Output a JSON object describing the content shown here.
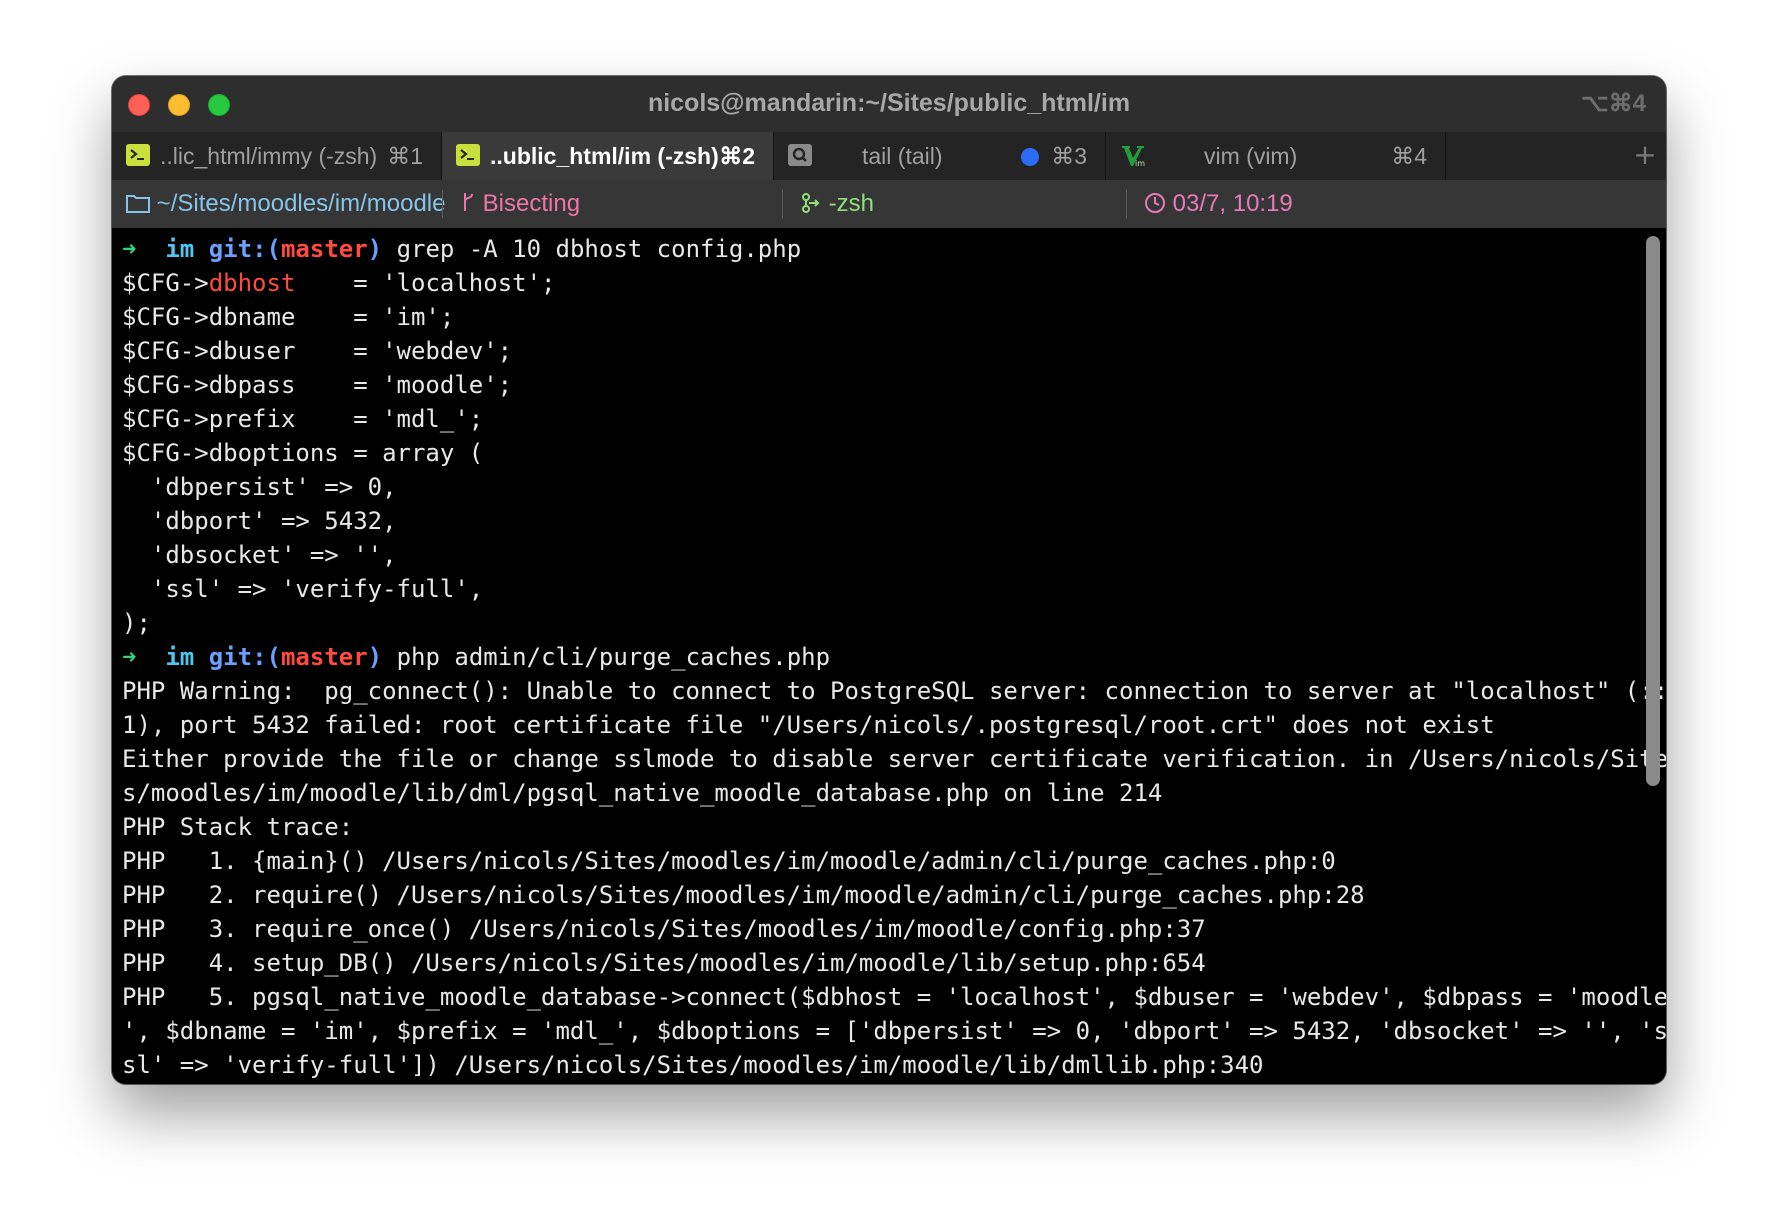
{
  "window": {
    "title": "nicols@mandarin:~/Sites/public_html/im",
    "shortcut": "⌥⌘4"
  },
  "tabs": [
    {
      "label": "..lic_html/immy (-zsh)",
      "shortcut": "⌘1",
      "icon": "terminal-icon",
      "active": false
    },
    {
      "label": "..ublic_html/im (-zsh)",
      "shortcut": "⌘2",
      "icon": "terminal-icon",
      "active": true
    },
    {
      "label": "tail (tail)",
      "shortcut": "⌘3",
      "icon": "search-icon",
      "active": false,
      "activity_dot": true
    },
    {
      "label": "vim (vim)",
      "shortcut": "⌘4",
      "icon": "vim-icon",
      "active": false
    }
  ],
  "new_tab": "+",
  "status": {
    "path": "~/Sites/moodles/im/moodle",
    "git_state": "Bisecting",
    "job": "-zsh",
    "time": "03/7, 10:19"
  },
  "colors": {
    "path": "#86c4e8",
    "git_state": "#ec77a6",
    "job": "#8fe07a",
    "time": "#e77ab8",
    "prompt_arrow": "#33d17a",
    "branch": "#ff4b3e"
  },
  "terminal": {
    "prompt_dir": "im",
    "prompt_git": "git:",
    "branch": "master",
    "cmd1": "grep -A 10 dbhost config.php",
    "cfg_prefix": "$CFG->",
    "cfg_match": "dbhost",
    "line1_rest": "    = 'localhost';",
    "lines_a": [
      "$CFG->dbname    = 'im';",
      "$CFG->dbuser    = 'webdev';",
      "$CFG->dbpass    = 'moodle';",
      "$CFG->prefix    = 'mdl_';",
      "$CFG->dboptions = array (",
      "  'dbpersist' => 0,",
      "  'dbport' => 5432,",
      "  'dbsocket' => '',",
      "  'ssl' => 'verify-full',",
      ");"
    ],
    "cmd2": "php admin/cli/purge_caches.php",
    "lines_b": [
      "PHP Warning:  pg_connect(): Unable to connect to PostgreSQL server: connection to server at \"localhost\" (::",
      "1), port 5432 failed: root certificate file \"/Users/nicols/.postgresql/root.crt\" does not exist",
      "Either provide the file or change sslmode to disable server certificate verification. in /Users/nicols/Site",
      "s/moodles/im/moodle/lib/dml/pgsql_native_moodle_database.php on line 214",
      "PHP Stack trace:",
      "PHP   1. {main}() /Users/nicols/Sites/moodles/im/moodle/admin/cli/purge_caches.php:0",
      "PHP   2. require() /Users/nicols/Sites/moodles/im/moodle/admin/cli/purge_caches.php:28",
      "PHP   3. require_once() /Users/nicols/Sites/moodles/im/moodle/config.php:37",
      "PHP   4. setup_DB() /Users/nicols/Sites/moodles/im/moodle/lib/setup.php:654",
      "PHP   5. pgsql_native_moodle_database->connect($dbhost = 'localhost', $dbuser = 'webdev', $dbpass = 'moodle",
      "', $dbname = 'im', $prefix = 'mdl_', $dboptions = ['dbpersist' => 0, 'dbport' => 5432, 'dbsocket' => '', 's",
      "sl' => 'verify-full']) /Users/nicols/Sites/moodles/im/moodle/lib/dmllib.php:340"
    ]
  }
}
